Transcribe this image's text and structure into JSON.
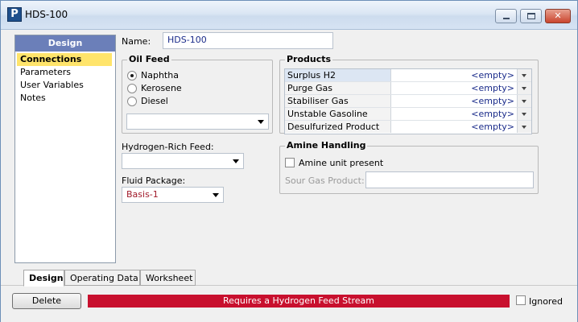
{
  "window": {
    "title": "HDS-100",
    "app_icon_letter": "P"
  },
  "nav": {
    "header": "Design",
    "items": [
      {
        "label": "Connections",
        "active": true
      },
      {
        "label": "Parameters",
        "active": false
      },
      {
        "label": "User Variables",
        "active": false
      },
      {
        "label": "Notes",
        "active": false
      }
    ]
  },
  "form": {
    "name_label": "Name:",
    "name_value": "HDS-100",
    "oil_feed": {
      "title": "Oil Feed",
      "options": [
        {
          "label": "Naphtha",
          "checked": true
        },
        {
          "label": "Kerosene",
          "checked": false
        },
        {
          "label": "Diesel",
          "checked": false
        }
      ],
      "stream_value": ""
    },
    "hydrogen_feed_label": "Hydrogen-Rich Feed:",
    "hydrogen_feed_value": "",
    "fluid_package_label": "Fluid Package:",
    "fluid_package_value": "Basis-1"
  },
  "products": {
    "title": "Products",
    "rows": [
      {
        "name": "Surplus H2",
        "value": "<empty>"
      },
      {
        "name": "Purge Gas",
        "value": "<empty>"
      },
      {
        "name": "Stabiliser Gas",
        "value": "<empty>"
      },
      {
        "name": "Unstable Gasoline",
        "value": "<empty>"
      },
      {
        "name": "Desulfurized Product",
        "value": "<empty>"
      }
    ]
  },
  "amine": {
    "title": "Amine Handling",
    "checkbox_label": "Amine unit present",
    "sour_gas_label": "Sour Gas Product:",
    "sour_gas_value": ""
  },
  "tabs": [
    {
      "label": "Design",
      "active": true
    },
    {
      "label": "Operating Data",
      "active": false
    },
    {
      "label": "Worksheet",
      "active": false
    }
  ],
  "footer": {
    "delete_label": "Delete",
    "status_text": "Requires a Hydrogen Feed Stream",
    "status_color": "#c8102e",
    "ignored_label": "Ignored"
  }
}
